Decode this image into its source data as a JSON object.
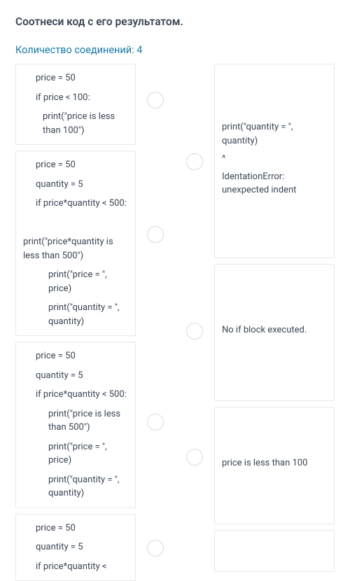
{
  "title": "Соотнеси код с его результатом.",
  "subtitle": "Количество соединений: 4",
  "left_cards": [
    {
      "lines": [
        {
          "text": "price = 50",
          "indent": 1
        },
        {
          "text": "if price < 100:",
          "indent": 1
        },
        {
          "text": "print(\"price is less than 100\")",
          "indent": 2
        }
      ]
    },
    {
      "lines": [
        {
          "text": "price = 50",
          "indent": 1
        },
        {
          "text": "quantity = 5",
          "indent": 1
        },
        {
          "text": "if price*quantity < 500:",
          "indent": 1
        },
        {
          "text": " ",
          "indent": 0
        },
        {
          "text": "print(\"price*quantity is less than 500\")",
          "indent": 0
        },
        {
          "text": "print(\"price = \", price)",
          "indent": 3
        },
        {
          "text": "print(\"quantity = \", quantity)",
          "indent": 3
        }
      ]
    },
    {
      "lines": [
        {
          "text": "price = 50",
          "indent": 1
        },
        {
          "text": "quantity = 5",
          "indent": 1
        },
        {
          "text": "if price*quantity < 500:",
          "indent": 1
        },
        {
          "text": "print(\"price is less than 500\")",
          "indent": 3
        },
        {
          "text": "print(\"price = \", price)",
          "indent": 3
        },
        {
          "text": "print(\"quantity = \", quantity)",
          "indent": 3
        }
      ]
    },
    {
      "lines": [
        {
          "text": "price = 50",
          "indent": 1
        },
        {
          "text": "quantity = 5",
          "indent": 1
        },
        {
          "text": "if price*quantity <",
          "indent": 1
        }
      ]
    }
  ],
  "right_cards": [
    {
      "lines": [
        "print(\"quantity = \", quantity)",
        "^",
        "IdentationError: unexpected indent"
      ]
    },
    {
      "lines": [
        "No if block executed."
      ]
    },
    {
      "lines": [
        "price is less than 100"
      ]
    },
    {
      "lines": [
        ""
      ]
    }
  ],
  "left_circle_positions": [
    40,
    232,
    500,
    680
  ],
  "right_circle_positions": [
    128,
    370,
    550
  ]
}
